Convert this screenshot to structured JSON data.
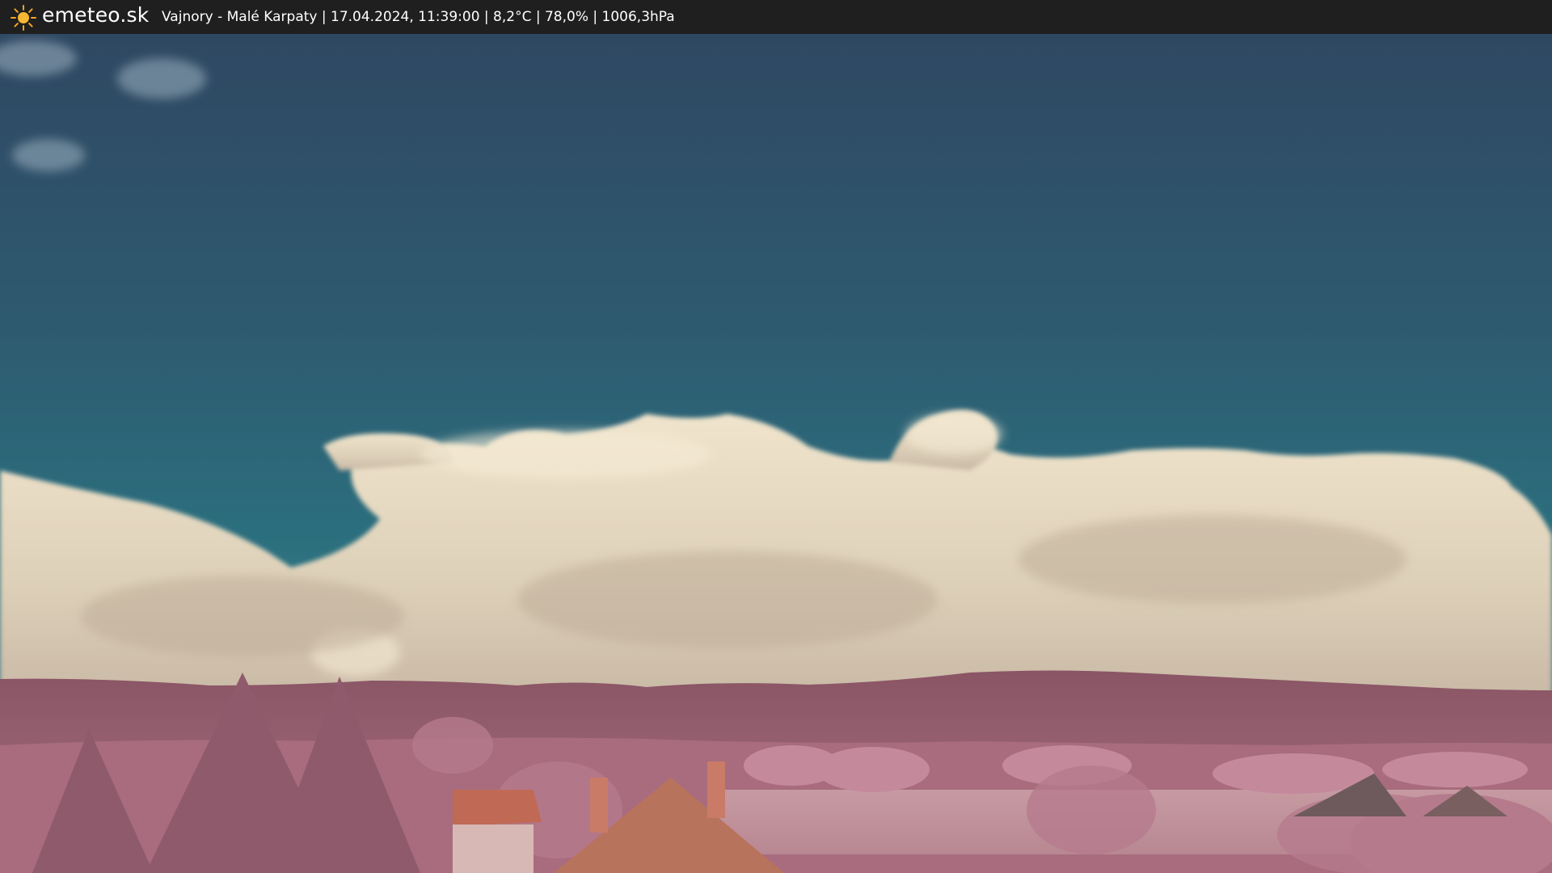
{
  "header": {
    "brand": "emeteo.sk",
    "caption": "Vajnory - Malé Karpaty | 17.04.2024, 11:39:00 | 8,2°C | 78,0% | 1006,3hPa",
    "logo_icon": "sun-icon"
  },
  "colors": {
    "bar": "#1f1f1f",
    "sun": "#f5a623",
    "sky_top": "#2e4660",
    "sky_horizon": "#2b7180",
    "cloud": "#e9dcc2",
    "hills": "#8c5a6a",
    "foliage": "#c48a9c",
    "roof": "#c06a55"
  }
}
